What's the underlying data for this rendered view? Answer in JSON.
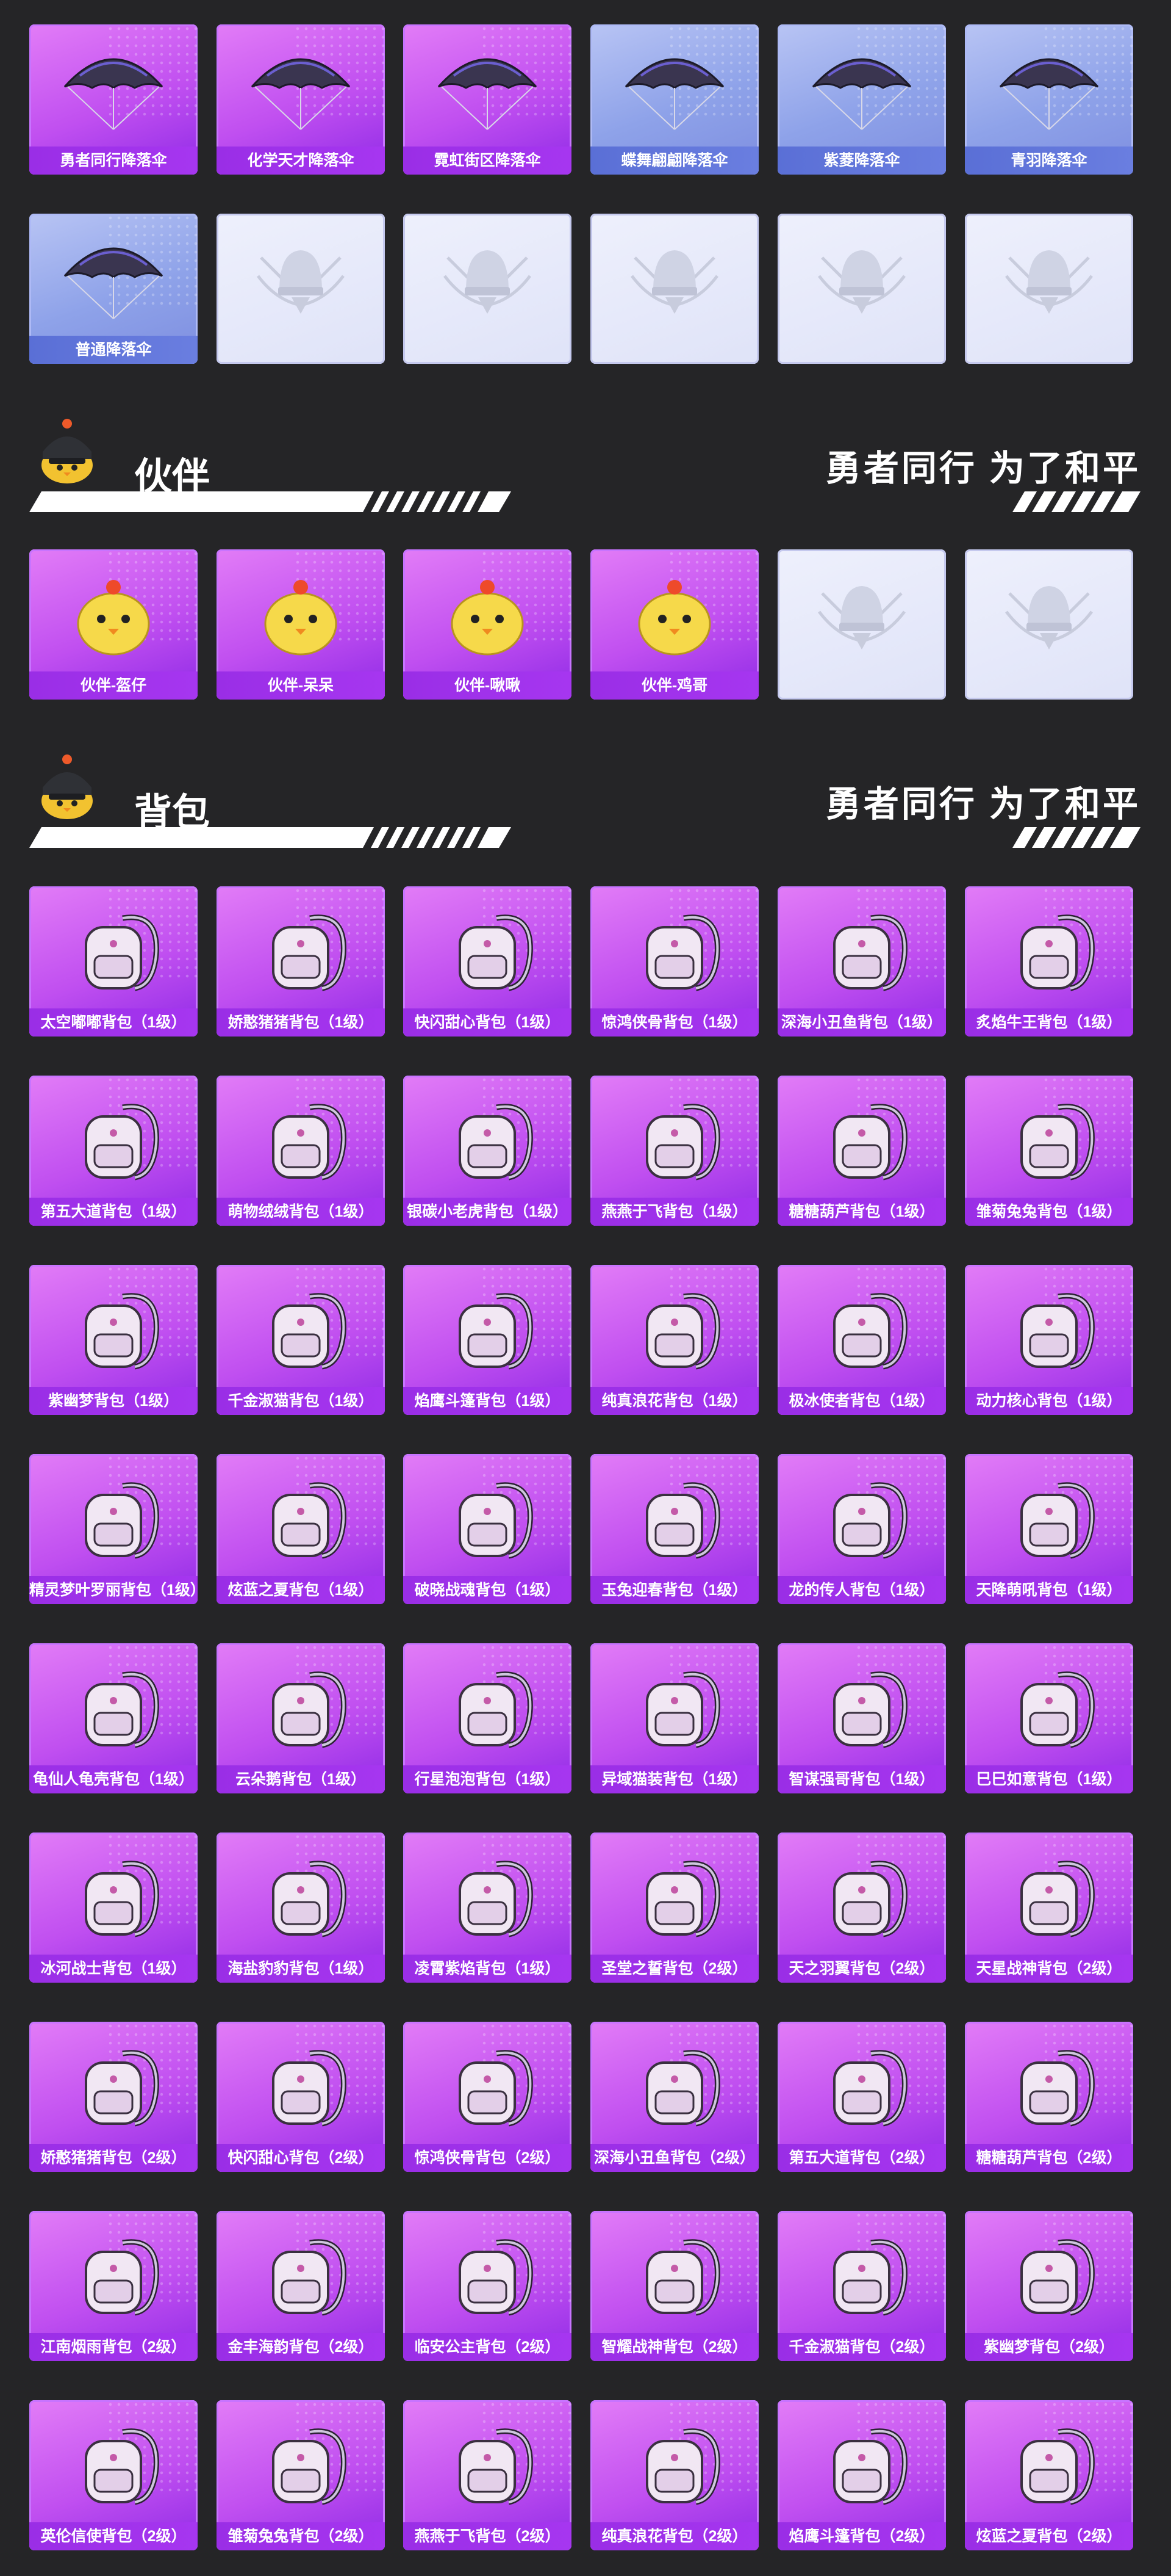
{
  "parachutes": {
    "items": [
      {
        "label": "勇者同行降落伞",
        "tier": "purple"
      },
      {
        "label": "化学天才降落伞",
        "tier": "purple"
      },
      {
        "label": "霓虹街区降落伞",
        "tier": "purple"
      },
      {
        "label": "蝶舞翩翩降落伞",
        "tier": "blue"
      },
      {
        "label": "紫菱降落伞",
        "tier": "blue"
      },
      {
        "label": "青羽降落伞",
        "tier": "blue"
      },
      {
        "label": "普通降落伞",
        "tier": "blue"
      },
      {
        "label": "",
        "tier": "empty"
      },
      {
        "label": "",
        "tier": "empty"
      },
      {
        "label": "",
        "tier": "empty"
      },
      {
        "label": "",
        "tier": "empty"
      },
      {
        "label": "",
        "tier": "empty"
      }
    ]
  },
  "companion": {
    "title": "伙伴",
    "slogan": "勇者同行 为了和平",
    "items": [
      {
        "label": "伙伴-盔仔",
        "tier": "purple"
      },
      {
        "label": "伙伴-呆呆",
        "tier": "purple"
      },
      {
        "label": "伙伴-啾啾",
        "tier": "purple"
      },
      {
        "label": "伙伴-鸡哥",
        "tier": "purple"
      },
      {
        "label": "",
        "tier": "empty"
      },
      {
        "label": "",
        "tier": "empty"
      }
    ]
  },
  "backpack": {
    "title": "背包",
    "slogan": "勇者同行 为了和平",
    "items": [
      {
        "label": "太空嘟嘟背包（1级）",
        "tier": "purple"
      },
      {
        "label": "娇憨猪猪背包（1级）",
        "tier": "purple"
      },
      {
        "label": "快闪甜心背包（1级）",
        "tier": "purple"
      },
      {
        "label": "惊鸿侠骨背包（1级）",
        "tier": "purple"
      },
      {
        "label": "深海小丑鱼背包（1级）",
        "tier": "purple"
      },
      {
        "label": "炙焰牛王背包（1级）",
        "tier": "purple"
      },
      {
        "label": "第五大道背包（1级）",
        "tier": "purple"
      },
      {
        "label": "萌物绒绒背包（1级）",
        "tier": "purple"
      },
      {
        "label": "银碳小老虎背包（1级）",
        "tier": "purple"
      },
      {
        "label": "燕燕于飞背包（1级）",
        "tier": "purple"
      },
      {
        "label": "糖糖葫芦背包（1级）",
        "tier": "purple"
      },
      {
        "label": "雏菊兔兔背包（1级）",
        "tier": "purple"
      },
      {
        "label": "紫幽梦背包（1级）",
        "tier": "purple"
      },
      {
        "label": "千金淑猫背包（1级）",
        "tier": "purple"
      },
      {
        "label": "焰鹰斗篷背包（1级）",
        "tier": "purple"
      },
      {
        "label": "纯真浪花背包（1级）",
        "tier": "purple"
      },
      {
        "label": "极冰使者背包（1级）",
        "tier": "purple"
      },
      {
        "label": "动力核心背包（1级）",
        "tier": "purple"
      },
      {
        "label": "精灵梦叶罗丽背包（1级）",
        "tier": "purple"
      },
      {
        "label": "炫蓝之夏背包（1级）",
        "tier": "purple"
      },
      {
        "label": "破晓战魂背包（1级）",
        "tier": "purple"
      },
      {
        "label": "玉兔迎春背包（1级）",
        "tier": "purple"
      },
      {
        "label": "龙的传人背包（1级）",
        "tier": "purple"
      },
      {
        "label": "天降萌吼背包（1级）",
        "tier": "purple"
      },
      {
        "label": "龟仙人龟壳背包（1级）",
        "tier": "purple"
      },
      {
        "label": "云朵鹅背包（1级）",
        "tier": "purple"
      },
      {
        "label": "行星泡泡背包（1级）",
        "tier": "purple"
      },
      {
        "label": "异域猫装背包（1级）",
        "tier": "purple"
      },
      {
        "label": "智谋强哥背包（1级）",
        "tier": "purple"
      },
      {
        "label": "巳巳如意背包（1级）",
        "tier": "purple"
      },
      {
        "label": "冰河战士背包（1级）",
        "tier": "purple"
      },
      {
        "label": "海盐豹豹背包（1级）",
        "tier": "purple"
      },
      {
        "label": "凌霄紫焰背包（1级）",
        "tier": "purple"
      },
      {
        "label": "圣堂之誓背包（2级）",
        "tier": "purple"
      },
      {
        "label": "天之羽翼背包（2级）",
        "tier": "purple"
      },
      {
        "label": "天星战神背包（2级）",
        "tier": "purple"
      },
      {
        "label": "娇憨猪猪背包（2级）",
        "tier": "purple"
      },
      {
        "label": "快闪甜心背包（2级）",
        "tier": "purple"
      },
      {
        "label": "惊鸿侠骨背包（2级）",
        "tier": "purple"
      },
      {
        "label": "深海小丑鱼背包（2级）",
        "tier": "purple"
      },
      {
        "label": "第五大道背包（2级）",
        "tier": "purple"
      },
      {
        "label": "糖糖葫芦背包（2级）",
        "tier": "purple"
      },
      {
        "label": "江南烟雨背包（2级）",
        "tier": "purple"
      },
      {
        "label": "金丰海韵背包（2级）",
        "tier": "purple"
      },
      {
        "label": "临安公主背包（2级）",
        "tier": "purple"
      },
      {
        "label": "智耀战神背包（2级）",
        "tier": "purple"
      },
      {
        "label": "千金淑猫背包（2级）",
        "tier": "purple"
      },
      {
        "label": "紫幽梦背包（2级）",
        "tier": "purple"
      },
      {
        "label": "英伦信使背包（2级）",
        "tier": "purple"
      },
      {
        "label": "雏菊兔兔背包（2级）",
        "tier": "purple"
      },
      {
        "label": "燕燕于飞背包（2级）",
        "tier": "purple"
      },
      {
        "label": "纯真浪花背包（2级）",
        "tier": "purple"
      },
      {
        "label": "焰鹰斗篷背包（2级）",
        "tier": "purple"
      },
      {
        "label": "炫蓝之夏背包（2级）",
        "tier": "purple"
      }
    ]
  }
}
